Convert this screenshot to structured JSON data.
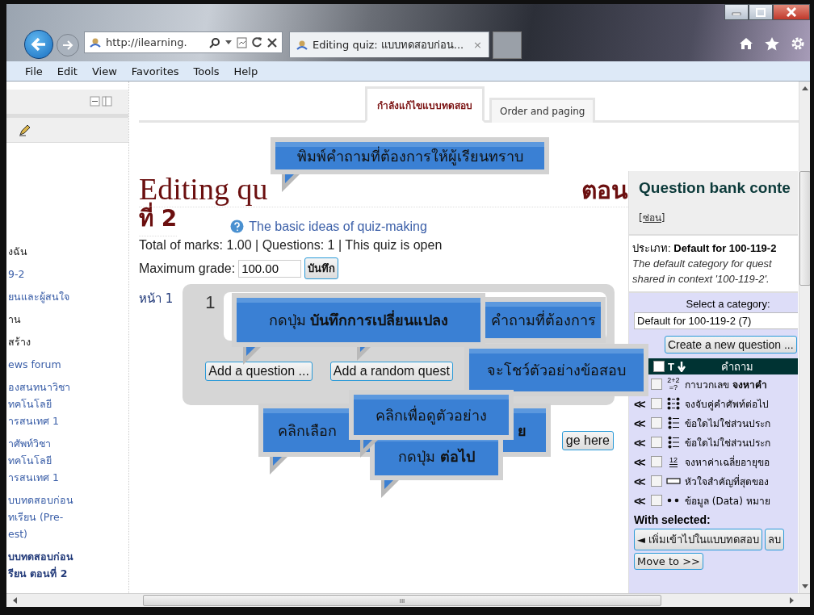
{
  "browser": {
    "address": "http://ilearning.",
    "tab_title": "Editing quiz: แบบทดสอบก่อน...",
    "tab_close": "×"
  },
  "menu": [
    "File",
    "Edit",
    "View",
    "Favorites",
    "Tools",
    "Help"
  ],
  "sidebar": {
    "items": [
      {
        "lines": [
          "งฉัน"
        ],
        "kind": "plain"
      },
      {
        "lines": [
          "9-2"
        ],
        "kind": "link"
      },
      {
        "lines": [
          "ยนและผู้สนใจ"
        ],
        "kind": "link"
      },
      {
        "lines": [
          "าน"
        ],
        "kind": "plain"
      },
      {
        "lines": [
          "สร้าง"
        ],
        "kind": "plain"
      },
      {
        "lines": [
          "ews forum"
        ],
        "kind": "link"
      },
      {
        "lines": [
          "องสนทนาวิชา",
          "ทคโนโลยี",
          "ารสนเทศ 1"
        ],
        "kind": "link"
      },
      {
        "lines": [
          "าศัพท์วิชา",
          "ทคโนโลยี",
          "ารสนเทศ 1"
        ],
        "kind": "link"
      },
      {
        "lines": [
          "บบทดสอบก่อน",
          "ทเรียน (Pre-",
          "est)"
        ],
        "kind": "link"
      },
      {
        "lines": [
          "บบทดสอบก่อน",
          "รียน ตอนที่ 2"
        ],
        "kind": "current"
      }
    ]
  },
  "tabs": [
    {
      "label": "กำลังแก้ไขแบบทดสอบ",
      "selected": true
    },
    {
      "label": "Order and paging",
      "selected": false
    }
  ],
  "heading": {
    "start": "Editing qu",
    "end": "ตอน",
    "line2": "ที่ 2"
  },
  "help_link": "The basic ideas of quiz-making",
  "summary": "Total of marks: 1.00 | Questions: 1 | This quiz is open",
  "max_grade": {
    "label": "Maximum grade:",
    "value": "100.00",
    "button": "บันทึก"
  },
  "page": {
    "label": "หน้า 1",
    "number": "1",
    "buttons": [
      "Add a question ...",
      "Add a random quest"
    ],
    "below_button": "ge here"
  },
  "bank": {
    "title": "Question bank conte",
    "hide": "[ซ่อน]",
    "category_label": "ประเภท:",
    "category_name": "Default for 100-119-2",
    "description": [
      "The default category for quest",
      "shared in context '100-119-2'."
    ],
    "select_label": "Select a category:",
    "select_value": "Default for 100-119-2 (7)",
    "create_button": "Create a new question ...",
    "columns": [
      "T",
      "คำถาม"
    ],
    "select_all_checked": false,
    "rows": [
      {
        "kind": "calculated",
        "icon_label": "2+2 =?",
        "text": "กาบวกเลข **จงหาคำ**",
        "checked": false
      },
      {
        "kind": "matching",
        "arrow": "<<",
        "text": "จงจับคู่คำศัพท์ต่อไป",
        "checked": false
      },
      {
        "kind": "multichoice",
        "arrow": "<<",
        "text": "ข้อใดไม่ใช่ส่วนประก",
        "checked": false
      },
      {
        "kind": "multichoice",
        "arrow": "<<",
        "text": "ข้อใดไม่ใช่ส่วนประก",
        "checked": false
      },
      {
        "kind": "numerical",
        "arrow": "<<",
        "icon_label": "12",
        "text": "จงหาค่าเฉลี่ยอายุขอ",
        "checked": false
      },
      {
        "kind": "shortanswer",
        "arrow": "<<",
        "text": "หัวใจสำคัญที่สุดของ",
        "checked": false
      },
      {
        "kind": "description",
        "arrow": "<<",
        "text": "ข้อมูล (Data) หมาย",
        "checked": false
      }
    ],
    "with_selected": "With selected:",
    "add_button": "◄ เพิ่มเข้าไปในแบบทดสอบ",
    "delete_button": "ลบ",
    "move_button": "Move to >>"
  },
  "callouts": [
    {
      "text": "พิมพ์คำถามที่ต้องการให้ผู้เรียนทราบ"
    },
    {
      "text": "กดปุ่ม  **บันทึกการเปลี่ยนแปลง**"
    },
    {
      "text": "คำถามที่ต้องการ"
    },
    {
      "text": "จะโชว์ตัวอย่างข้อสอบ"
    },
    {
      "text": "คลิกเพื่อดูตัวอย่าง"
    },
    {
      "text": "คลิกเลือก",
      "text_right": "ย"
    },
    {
      "text": "กดปุ่ม **ต่อไป**"
    }
  ],
  "hscroll_grip": "III"
}
